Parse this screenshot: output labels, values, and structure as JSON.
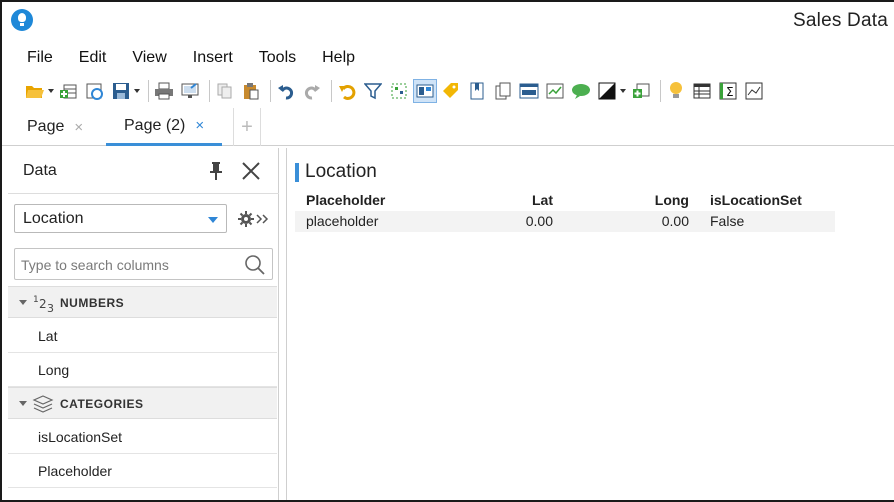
{
  "window": {
    "title": "Sales Data"
  },
  "menu": [
    "File",
    "Edit",
    "View",
    "Insert",
    "Tools",
    "Help"
  ],
  "toolbar": {
    "icons": [
      "open-folder-icon",
      "add-data-icon",
      "refresh-icon",
      "save-icon",
      "print-icon",
      "export-icon",
      "copy-icon",
      "paste-icon",
      "undo-icon",
      "redo-icon",
      "reset-icon",
      "filter-icon",
      "select-icon",
      "layout-icon",
      "tag-icon",
      "bookmark-icon",
      "pages-icon",
      "http-icon",
      "chart-icon",
      "comment-icon",
      "contrast-icon",
      "new-visual-icon",
      "insights-icon",
      "table-icon",
      "sum-icon",
      "chart-line-icon"
    ]
  },
  "tabs": [
    {
      "label": "Page",
      "close": "×"
    },
    {
      "label": "Page (2)",
      "close": "×"
    }
  ],
  "tab_add": "+",
  "data_panel": {
    "title": "Data",
    "source": "Location",
    "search_placeholder": "Type to search columns",
    "groups": [
      {
        "label": "NUMBERS",
        "icon": "numbers-icon",
        "fields": [
          "Lat",
          "Long"
        ]
      },
      {
        "label": "CATEGORIES",
        "icon": "categories-icon",
        "fields": [
          "isLocationSet",
          "Placeholder"
        ]
      }
    ]
  },
  "visual": {
    "title": "Location",
    "columns": [
      "Placeholder",
      "Lat",
      "Long",
      "isLocationSet"
    ],
    "rows": [
      [
        "placeholder",
        "0.00",
        "0.00",
        "False"
      ]
    ]
  },
  "colors": {
    "accent": "#3a8fd8",
    "tab_close_active": "#2f86d6"
  }
}
